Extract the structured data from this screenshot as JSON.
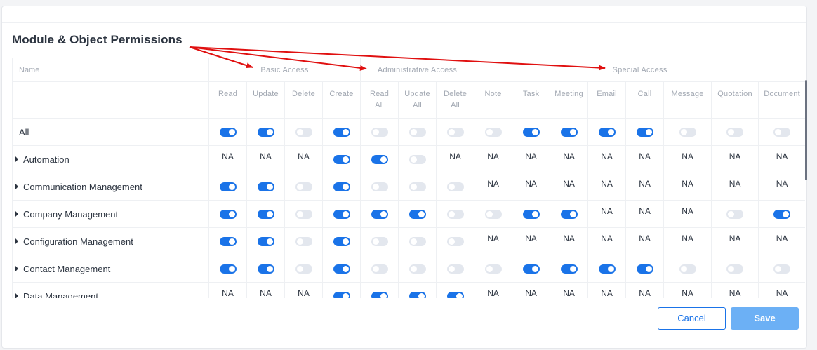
{
  "title": "Module & Object Permissions",
  "columns_header": "Name",
  "groups": [
    "Basic Access",
    "Administrative Access",
    "Special Access"
  ],
  "columns": [
    {
      "key": "read",
      "label": "Read",
      "group": "Basic Access"
    },
    {
      "key": "update",
      "label": "Update",
      "group": "Basic Access"
    },
    {
      "key": "delete",
      "label": "Delete",
      "group": "Basic Access"
    },
    {
      "key": "create",
      "label": "Create",
      "group": "Basic Access"
    },
    {
      "key": "read_all",
      "label": "Read\nAll",
      "group": "Administrative Access"
    },
    {
      "key": "update_all",
      "label": "Update\nAll",
      "group": "Administrative Access"
    },
    {
      "key": "delete_all",
      "label": "Delete\nAll",
      "group": "Administrative Access"
    },
    {
      "key": "note",
      "label": "Note",
      "group": "Special Access"
    },
    {
      "key": "task",
      "label": "Task",
      "group": "Special Access"
    },
    {
      "key": "meeting",
      "label": "Meeting",
      "group": "Special Access"
    },
    {
      "key": "email",
      "label": "Email",
      "group": "Special Access"
    },
    {
      "key": "call",
      "label": "Call",
      "group": "Special Access"
    },
    {
      "key": "message",
      "label": "Message",
      "group": "Special Access"
    },
    {
      "key": "quotation",
      "label": "Quotation",
      "group": "Special Access"
    },
    {
      "key": "document",
      "label": "Document",
      "group": "Special Access"
    }
  ],
  "na_label": "NA",
  "rows": [
    {
      "name": "All",
      "expandable": false,
      "values": [
        "on",
        "on",
        "off",
        "on",
        "off",
        "off",
        "off",
        "off",
        "on",
        "on",
        "on",
        "on",
        "off",
        "off",
        "off"
      ]
    },
    {
      "name": "Automation",
      "expandable": true,
      "values": [
        "NA",
        "NA",
        "NA",
        "on",
        "on",
        "off",
        "NA",
        "NA",
        "NA",
        "NA",
        "NA",
        "NA",
        "NA",
        "NA",
        "NA"
      ]
    },
    {
      "name": "Communication Management",
      "expandable": true,
      "values": [
        "on",
        "on",
        "off",
        "on",
        "off",
        "off",
        "off",
        "NA",
        "NA",
        "NA",
        "NA",
        "NA",
        "NA",
        "NA",
        "NA"
      ]
    },
    {
      "name": "Company Management",
      "expandable": true,
      "values": [
        "on",
        "on",
        "off",
        "on",
        "on",
        "on",
        "off",
        "off",
        "on",
        "on",
        "NA",
        "NA",
        "NA",
        "off",
        "on"
      ]
    },
    {
      "name": "Configuration Management",
      "expandable": true,
      "values": [
        "on",
        "on",
        "off",
        "on",
        "off",
        "off",
        "off",
        "NA",
        "NA",
        "NA",
        "NA",
        "NA",
        "NA",
        "NA",
        "NA"
      ]
    },
    {
      "name": "Contact Management",
      "expandable": true,
      "values": [
        "on",
        "on",
        "off",
        "on",
        "off",
        "off",
        "off",
        "off",
        "on",
        "on",
        "on",
        "on",
        "off",
        "off",
        "off"
      ]
    },
    {
      "name": "Data Management",
      "expandable": true,
      "values": [
        "NA",
        "NA",
        "NA",
        "on",
        "on",
        "on",
        "on",
        "NA",
        "NA",
        "NA",
        "NA",
        "NA",
        "NA",
        "NA",
        "NA"
      ]
    }
  ],
  "buttons": {
    "cancel": "Cancel",
    "save": "Save"
  },
  "colors": {
    "toggle_on": "#1a73e8",
    "toggle_off": "#e3e7ee",
    "annotation_arrow": "#e01010",
    "save_button": "#6cb0f5"
  }
}
